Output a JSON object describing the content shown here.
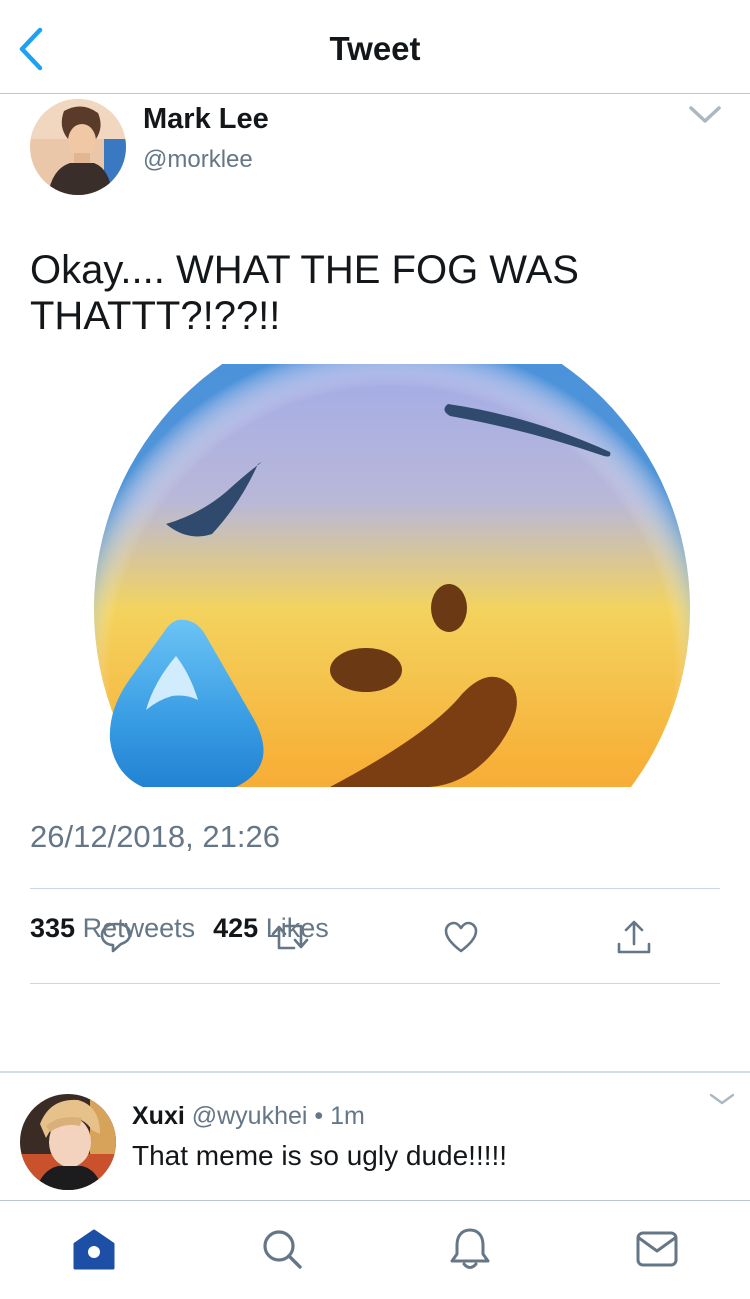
{
  "colors": {
    "accent": "#1da1f2",
    "home_active": "#1c4fa5",
    "icon_gray": "#657786",
    "text": "#14171a"
  },
  "nav": {
    "title": "Tweet",
    "back_icon": "chevron-left-icon"
  },
  "tweet": {
    "author_name": "Mark Lee",
    "author_handle": "@morklee",
    "text": "Okay.... WHAT THE FOG WAS THATTT?!??!!",
    "timestamp": "26/12/2018, 21:26",
    "retweets_count": "335",
    "retweets_label": "Retweets",
    "likes_count": "425",
    "likes_label": "Likes",
    "media_icon": "cold-sweat-emoji"
  },
  "actions": [
    "reply-icon",
    "retweet-icon",
    "like-icon",
    "share-icon"
  ],
  "reply": {
    "name": "Xuxi",
    "handle": "@wyukhei",
    "separator": "•",
    "time": "1m",
    "text": "That meme is so ugly dude!!!!!"
  },
  "tabbar": [
    "home-icon",
    "search-icon",
    "notifications-icon",
    "messages-icon"
  ]
}
